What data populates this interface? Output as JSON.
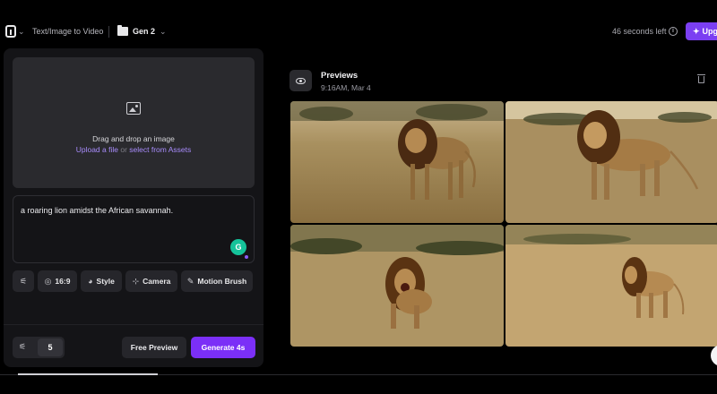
{
  "topbar": {
    "mode_label": "Text/Image to Video",
    "model_label": "Gen 2",
    "timer": "46 seconds left",
    "upgrade_label": "Upg"
  },
  "panel": {
    "dropzone": {
      "title": "Drag and drop an image",
      "upload_link": "Upload a file",
      "or_text": "or",
      "assets_link": "select from Assets"
    },
    "prompt": {
      "value": "a roaring lion amidst the African savannah."
    },
    "tools": {
      "aspect_label": "16:9",
      "style_label": "Style",
      "camera_label": "Camera",
      "motion_label": "Motion Brush"
    },
    "count_value": "5",
    "free_preview_label": "Free Preview",
    "generate_label": "Generate 4s"
  },
  "previews": {
    "title": "Previews",
    "timestamp": "9:16AM, Mar 4",
    "thumbnails": [
      {
        "subject": "standing lion in savannah"
      },
      {
        "subject": "walking lion in savannah"
      },
      {
        "subject": "roaring lion in savannah"
      },
      {
        "subject": "lion in profile in savannah"
      }
    ]
  },
  "colors": {
    "accent": "#7b2ff7",
    "panel_bg": "#141417",
    "link": "#a78bfa"
  }
}
